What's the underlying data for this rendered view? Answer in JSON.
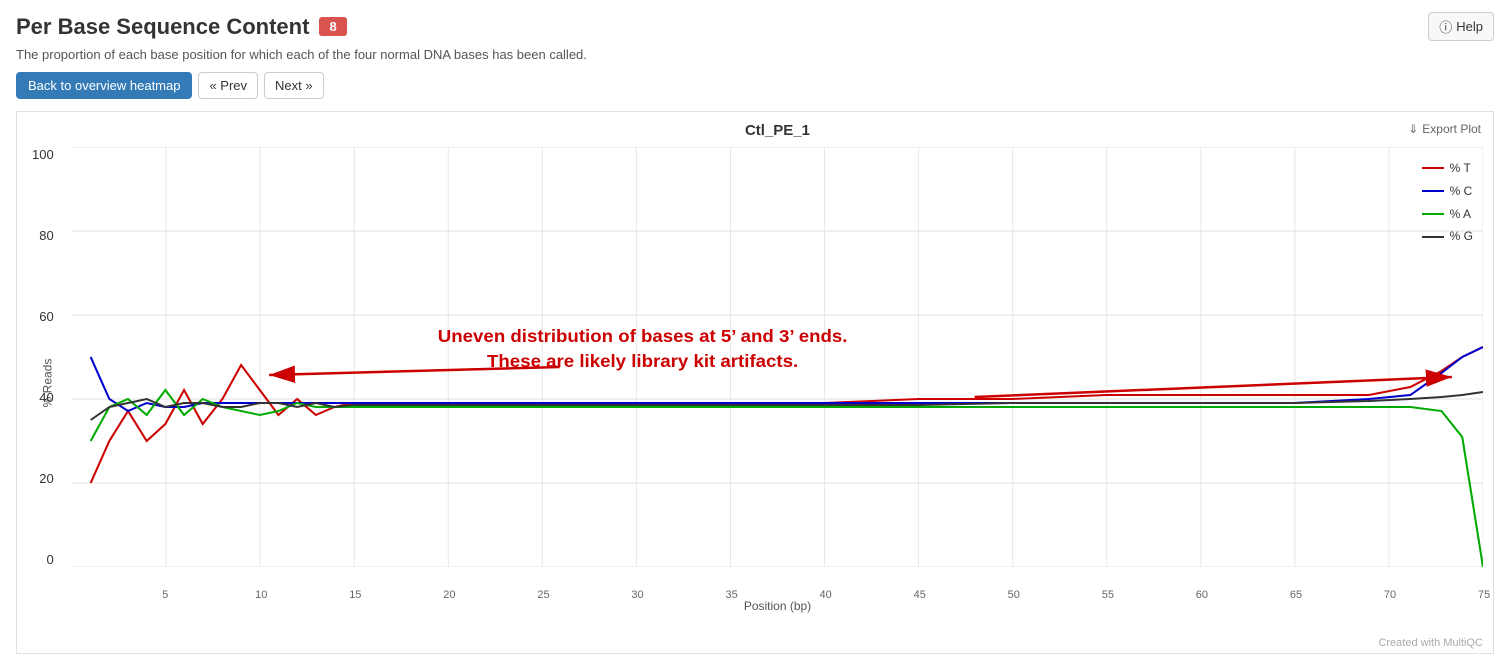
{
  "page": {
    "title": "Per Base Sequence Content",
    "badge": "8",
    "subtitle": "The proportion of each base position for which each of the four normal DNA bases has been called.",
    "help_label": "Help"
  },
  "toolbar": {
    "back_label": "Back to overview heatmap",
    "prev_label": "« Prev",
    "next_label": "Next »"
  },
  "chart": {
    "title": "Ctl_PE_1",
    "export_label": "Export Plot",
    "y_axis_label": "% Reads",
    "x_axis_label": "Position (bp)",
    "y_ticks": [
      "100",
      "80",
      "60",
      "40",
      "20",
      "0"
    ],
    "x_ticks": [
      "5",
      "10",
      "15",
      "20",
      "25",
      "30",
      "35",
      "40",
      "45",
      "50",
      "55",
      "60",
      "65",
      "70",
      "75"
    ],
    "legend": [
      {
        "label": "% T",
        "color": "#cc0000"
      },
      {
        "label": "% C",
        "color": "#0000cc"
      },
      {
        "label": "% A",
        "color": "#00aa00"
      },
      {
        "label": "% G",
        "color": "#333333"
      }
    ],
    "annotation": "Uneven distribution of bases at 5’ and 3’ ends.\nThese are likely library kit artifacts.",
    "credit": "Created with MultiQC"
  }
}
